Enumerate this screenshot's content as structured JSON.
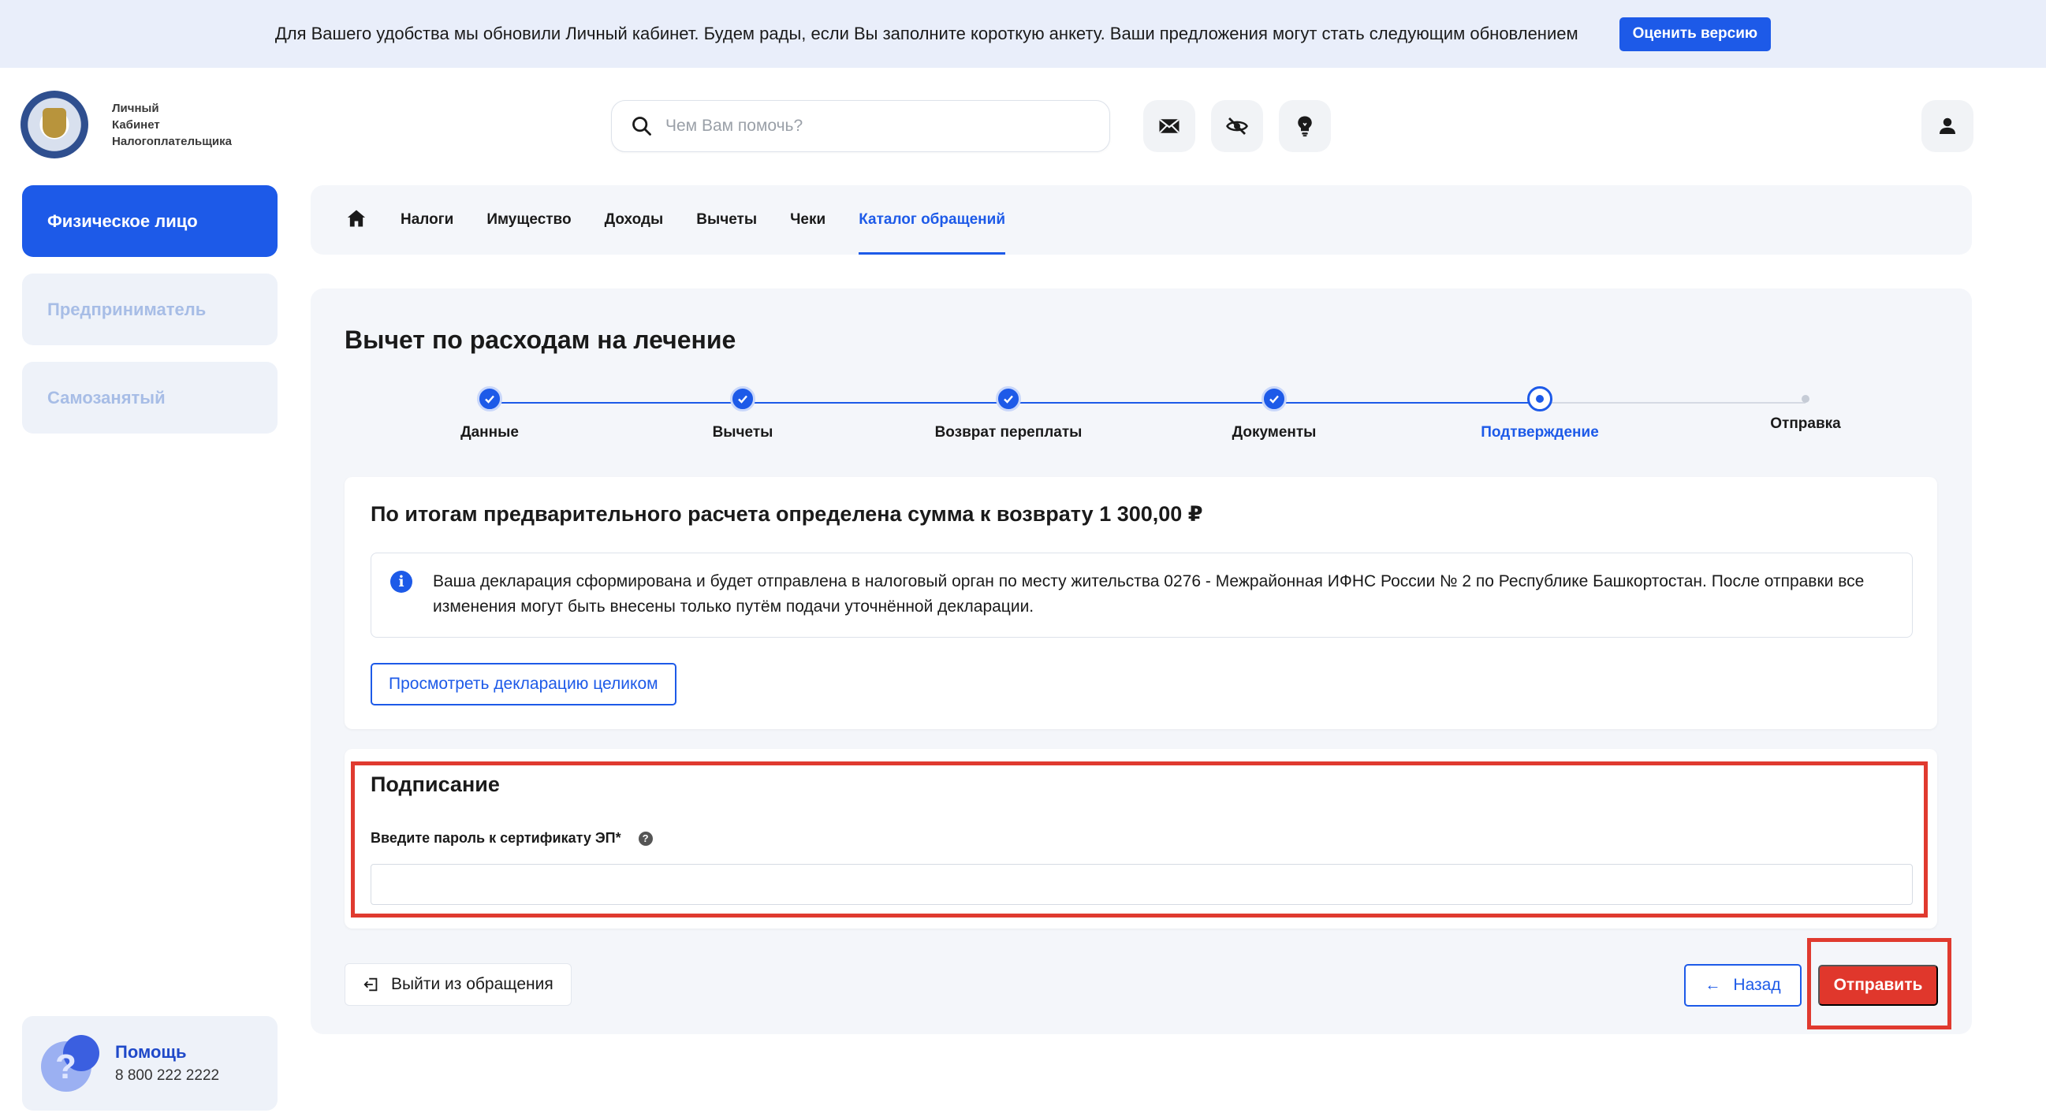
{
  "banner": {
    "text": "Для Вашего удобства мы обновили Личный кабинет. Будем рады, если Вы заполните короткую анкету. Ваши предложения могут стать следующим обновлением",
    "button": "Оценить версию"
  },
  "logo": {
    "line1": "Личный",
    "line2": "Кабинет",
    "line3": "Налогоплательщика"
  },
  "search": {
    "placeholder": "Чем Вам помочь?"
  },
  "sidebar": {
    "items": [
      {
        "label": "Физическое лицо"
      },
      {
        "label": "Предприниматель"
      },
      {
        "label": "Самозанятый"
      }
    ],
    "help": {
      "title": "Помощь",
      "phone": "8 800 222 2222"
    }
  },
  "tabs": [
    {
      "label": "Налоги"
    },
    {
      "label": "Имущество"
    },
    {
      "label": "Доходы"
    },
    {
      "label": "Вычеты"
    },
    {
      "label": "Чеки"
    },
    {
      "label": "Каталог обращений"
    }
  ],
  "page": {
    "title": "Вычет по расходам на лечение"
  },
  "stepper": {
    "steps": [
      {
        "label": "Данные",
        "state": "done"
      },
      {
        "label": "Вычеты",
        "state": "done"
      },
      {
        "label": "Возврат переплаты",
        "state": "done"
      },
      {
        "label": "Документы",
        "state": "done"
      },
      {
        "label": "Подтверждение",
        "state": "current"
      },
      {
        "label": "Отправка",
        "state": "pending"
      }
    ]
  },
  "summary": {
    "title": "По итогам предварительного расчета определена сумма к возврату 1 300,00 ₽",
    "info": "Ваша декларация сформирована и будет отправлена в налоговый орган по месту жительства 0276 - Межрайонная ИФНС России № 2 по Республике Башкортостан. После отправки все изменения могут быть внесены только путём подачи уточнённой декларации.",
    "view_button": "Просмотреть декларацию целиком"
  },
  "signing": {
    "title": "Подписание",
    "password_label": "Введите пароль к сертификату ЭП*",
    "password_value": ""
  },
  "actions": {
    "exit": "Выйти из обращения",
    "back": "Назад",
    "send": "Отправить"
  },
  "colors": {
    "accent": "#1d5ae8",
    "danger": "#e0372c",
    "highlight": "#e03a2f",
    "banner_bg": "#e9eefa",
    "panel_bg": "#f4f6fa"
  }
}
